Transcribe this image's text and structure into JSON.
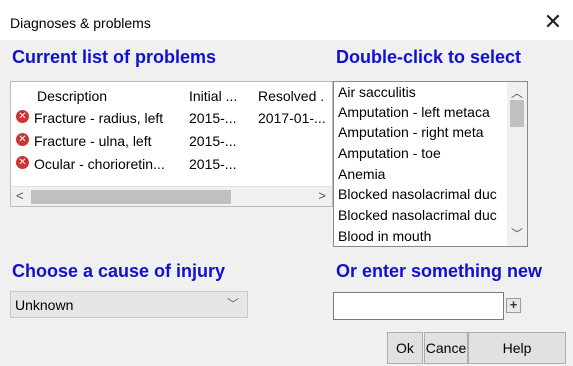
{
  "window": {
    "title": "Diagnoses & problems"
  },
  "headings": {
    "current_list": "Current list of problems",
    "double_click": "Double-click to select",
    "cause": "Choose a cause of injury",
    "enter_new": "Or enter something new"
  },
  "problems": {
    "columns": [
      "Description",
      "Initial ...",
      "Resolved ."
    ],
    "rows": [
      {
        "description": "Fracture - radius, left",
        "initial": "2015-...",
        "resolved": "2017-01-..."
      },
      {
        "description": "Fracture - ulna, left",
        "initial": "2015-...",
        "resolved": ""
      },
      {
        "description": "Ocular - chorioretin...",
        "initial": "2015-...",
        "resolved": ""
      }
    ]
  },
  "select_list": {
    "items": [
      "Air sacculitis",
      "Amputation - left metaca",
      "Amputation - right meta",
      "Amputation - toe",
      "Anemia",
      "Blocked nasolacrimal duc",
      "Blocked nasolacrimal duc",
      "Blood in mouth"
    ]
  },
  "cause": {
    "selected": "Unknown"
  },
  "new_entry": {
    "value": "",
    "add_label": "+"
  },
  "buttons": {
    "ok": "Ok",
    "cancel": "Cance",
    "help": "Help"
  },
  "icons": {
    "close": "close-icon",
    "error": "error-icon",
    "chevron": "chevron-down-icon"
  },
  "colors": {
    "heading": "#1010d0",
    "error": "#cc3333",
    "dialog_bg": "#f0f0f0"
  }
}
